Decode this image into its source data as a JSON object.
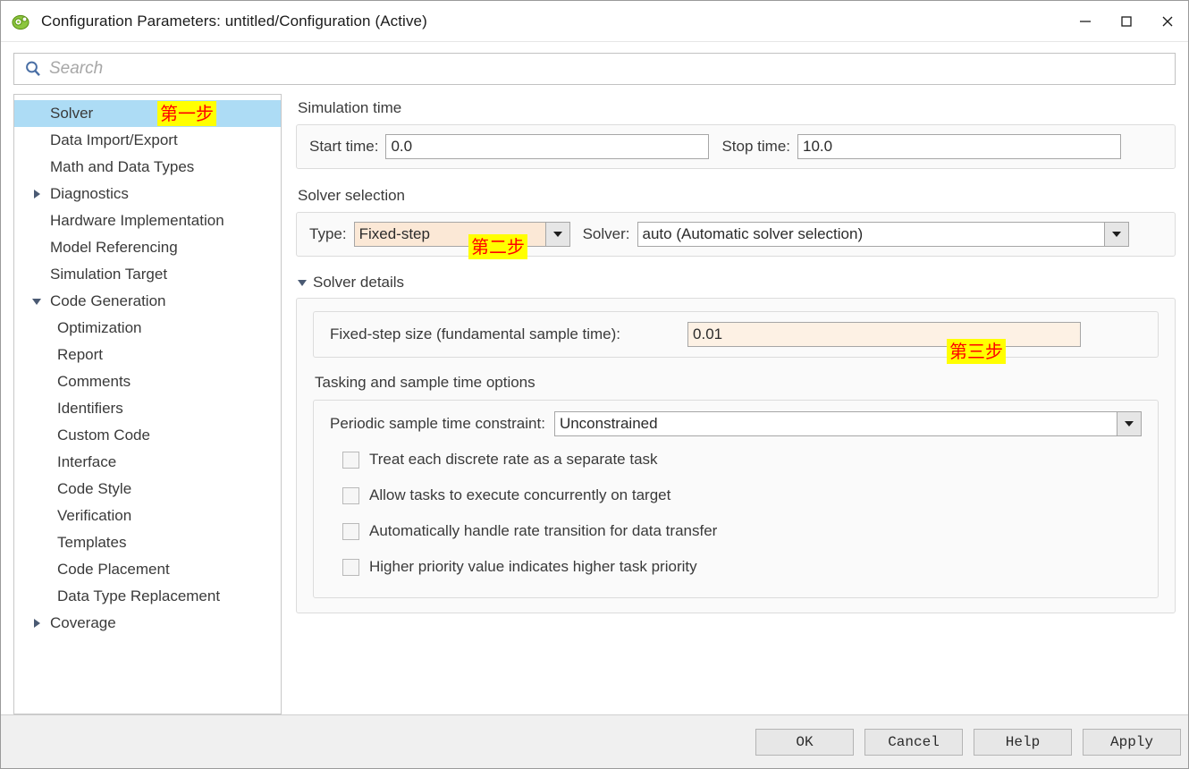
{
  "window": {
    "title": "Configuration Parameters: untitled/Configuration (Active)",
    "app_icon": "simulink-gear-icon",
    "minimize_label": "Minimize",
    "maximize_label": "Maximize",
    "close_label": "Close"
  },
  "search": {
    "icon": "search-icon",
    "placeholder": "Search",
    "value": ""
  },
  "tree": {
    "selected": "Solver",
    "items": [
      {
        "label": "Solver",
        "level": 0,
        "twisty": "none",
        "selected": true
      },
      {
        "label": "Data Import/Export",
        "level": 0,
        "twisty": "none",
        "selected": false
      },
      {
        "label": "Math and Data Types",
        "level": 0,
        "twisty": "none",
        "selected": false
      },
      {
        "label": "Diagnostics",
        "level": 0,
        "twisty": "collapsed",
        "selected": false
      },
      {
        "label": "Hardware Implementation",
        "level": 0,
        "twisty": "none",
        "selected": false
      },
      {
        "label": "Model Referencing",
        "level": 0,
        "twisty": "none",
        "selected": false
      },
      {
        "label": "Simulation Target",
        "level": 0,
        "twisty": "none",
        "selected": false
      },
      {
        "label": "Code Generation",
        "level": 0,
        "twisty": "expanded",
        "selected": false
      },
      {
        "label": "Optimization",
        "level": 1,
        "twisty": "none",
        "selected": false
      },
      {
        "label": "Report",
        "level": 1,
        "twisty": "none",
        "selected": false
      },
      {
        "label": "Comments",
        "level": 1,
        "twisty": "none",
        "selected": false
      },
      {
        "label": "Identifiers",
        "level": 1,
        "twisty": "none",
        "selected": false
      },
      {
        "label": "Custom Code",
        "level": 1,
        "twisty": "none",
        "selected": false
      },
      {
        "label": "Interface",
        "level": 1,
        "twisty": "none",
        "selected": false
      },
      {
        "label": "Code Style",
        "level": 1,
        "twisty": "none",
        "selected": false
      },
      {
        "label": "Verification",
        "level": 1,
        "twisty": "none",
        "selected": false
      },
      {
        "label": "Templates",
        "level": 1,
        "twisty": "none",
        "selected": false
      },
      {
        "label": "Code Placement",
        "level": 1,
        "twisty": "none",
        "selected": false
      },
      {
        "label": "Data Type Replacement",
        "level": 1,
        "twisty": "none",
        "selected": false
      },
      {
        "label": "Coverage",
        "level": 0,
        "twisty": "collapsed",
        "selected": false
      }
    ]
  },
  "main": {
    "simulation_time": {
      "title": "Simulation time",
      "start_label": "Start time:",
      "start_value": "0.0",
      "stop_label": "Stop time:",
      "stop_value": "10.0"
    },
    "solver_selection": {
      "title": "Solver selection",
      "type_label": "Type:",
      "type_value": "Fixed-step",
      "solver_label": "Solver:",
      "solver_value": "auto (Automatic solver selection)"
    },
    "solver_details": {
      "title": "Solver details",
      "fixed_step_label": "Fixed-step size (fundamental sample time):",
      "fixed_step_value": "0.01",
      "tasking_title": "Tasking and sample time options",
      "periodic_label": "Periodic sample time constraint:",
      "periodic_value": "Unconstrained",
      "checkboxes": [
        {
          "label": "Treat each discrete rate as a separate task",
          "checked": false
        },
        {
          "label": "Allow tasks to execute concurrently on target",
          "checked": false
        },
        {
          "label": "Automatically handle rate transition for data transfer",
          "checked": false
        },
        {
          "label": "Higher priority value indicates higher task priority",
          "checked": false
        }
      ]
    }
  },
  "annotations": [
    {
      "text": "第一步",
      "target": "tree-solver"
    },
    {
      "text": "第二步",
      "target": "solver-type-combo"
    },
    {
      "text": "第三步",
      "target": "fixed-step-size-field"
    }
  ],
  "footer": {
    "buttons": [
      {
        "label": "OK"
      },
      {
        "label": "Cancel"
      },
      {
        "label": "Help"
      },
      {
        "label": "Apply"
      }
    ]
  },
  "colors": {
    "selection": "#addcf5",
    "modified_field": "#fdf1e4",
    "annotation_bg": "#ffff00",
    "annotation_fg": "#ff0000",
    "footer_bg": "#f0f0f0"
  }
}
